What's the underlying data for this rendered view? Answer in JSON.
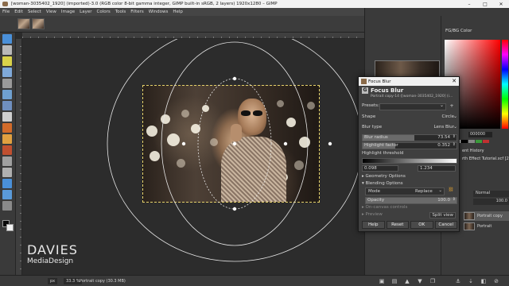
{
  "window": {
    "title": "[woman-3035402_1920] (imported)-3.0 (RGB color 8-bit gamma integer, GIMP built-in sRGB, 2 layers) 1920x1280 – GIMP",
    "minimize": "–",
    "maximize": "□",
    "close": "✕"
  },
  "menu": [
    "File",
    "Edit",
    "Select",
    "View",
    "Image",
    "Layer",
    "Colors",
    "Tools",
    "Filters",
    "Windows",
    "Help"
  ],
  "watermark": {
    "brand": "DAVIES",
    "sub": "MediaDesign"
  },
  "status": {
    "unit": "px",
    "zoom": "33.3 %",
    "text": "Portrait copy (30.3 MB)"
  },
  "dock": {
    "fgbg_tab": "FG/BG Color",
    "hex_value": "000000",
    "layers_partial_title": "ent History",
    "effect_partial": "rth Effect Tutorial.xcf [2",
    "mode_value": "Normal",
    "opacity_value": "100.0",
    "layers": [
      {
        "name": "Portrait copy",
        "selected": true
      },
      {
        "name": "Portrait",
        "selected": false
      }
    ]
  },
  "dialog": {
    "window_title": "Focus Blur",
    "filter_name": "Focus Blur",
    "filter_sub": "Portrait copy-14 ([woman-3035402_1920] (i...",
    "presets_label": "Presets:",
    "add_preset": "+",
    "shape_label": "Shape",
    "shape_value": "Circle",
    "blur_type_label": "Blur type",
    "blur_type_value": "Lens Blur",
    "blur_radius_label": "Blur radius",
    "blur_radius_value": "73.54",
    "highlight_factor_label": "Highlight factor",
    "highlight_factor_value": "0.352",
    "highlight_threshold_label": "Highlight threshold",
    "threshold_low": "0.098",
    "threshold_high": "1.234",
    "geometry_options": "Geometry Options",
    "blending_options": "Blending Options",
    "mode_label": "Mode",
    "mode_value": "Replace",
    "opacity_label": "Opacity",
    "opacity_value": "100.0",
    "on_canvas_controls": "On-canvas controls",
    "preview_label": "Preview",
    "split_view": "Split view",
    "buttons": {
      "help": "Help",
      "reset": "Reset",
      "ok": "OK",
      "cancel": "Cancel"
    },
    "blur_radius_fill": 0.55,
    "highlight_factor_fill": 0.35
  },
  "icons": {
    "dropdown": "⌄",
    "expander_collapsed": "▸",
    "expander_expanded": "▾",
    "chain": "⛓"
  },
  "colors": {
    "selection_outline": "#e5d26a",
    "layer_selected": "#5a5a5a"
  }
}
